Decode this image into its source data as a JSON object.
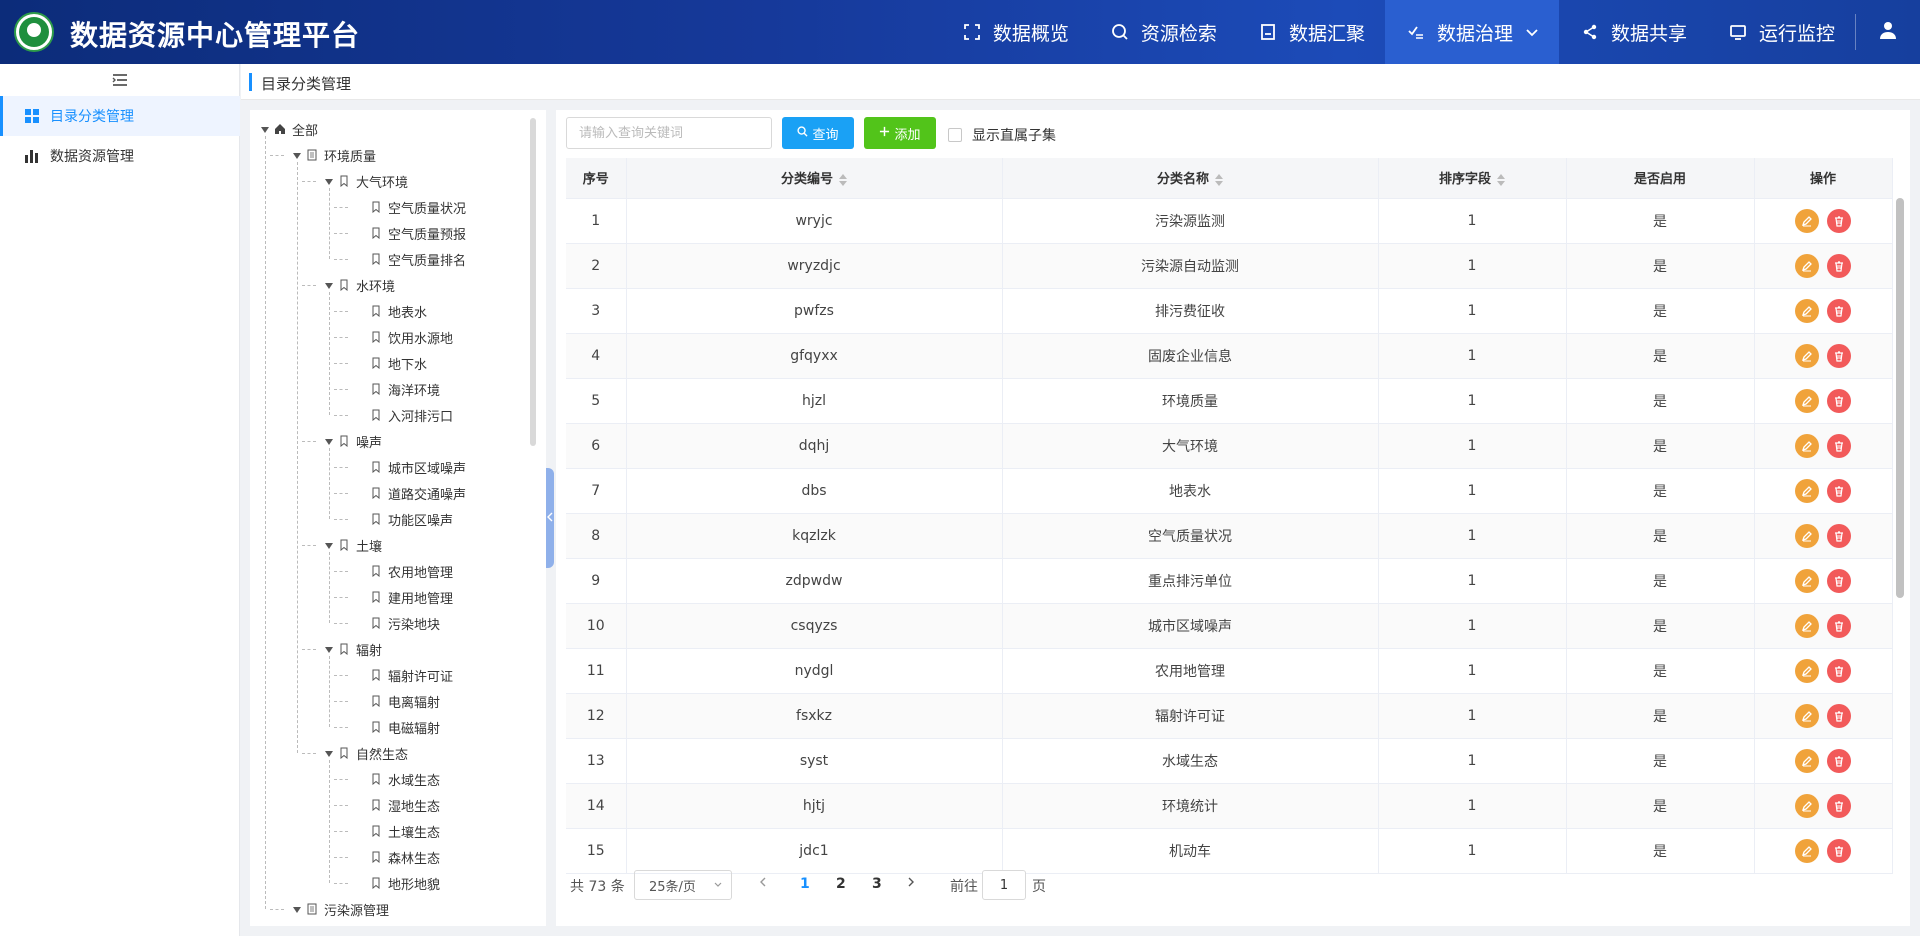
{
  "header": {
    "title": "数据资源中心管理平台",
    "nav": [
      {
        "label": "数据概览",
        "icon": "expand-icon",
        "active": false
      },
      {
        "label": "资源检索",
        "icon": "search-icon",
        "active": false
      },
      {
        "label": "数据汇聚",
        "icon": "document-icon",
        "active": false
      },
      {
        "label": "数据治理",
        "icon": "check-list-icon",
        "active": true
      },
      {
        "label": "数据共享",
        "icon": "share-icon",
        "active": false
      },
      {
        "label": "运行监控",
        "icon": "monitor-icon",
        "active": false
      }
    ],
    "user_icon": "user-icon"
  },
  "sidebar": {
    "items": [
      {
        "label": "目录分类管理",
        "icon": "grid-icon",
        "active": true
      },
      {
        "label": "数据资源管理",
        "icon": "bar-chart-icon",
        "active": false
      }
    ]
  },
  "breadcrumb": "目录分类管理",
  "tree": {
    "root": "全部",
    "l1_env": "环境质量",
    "groups": [
      {
        "label": "大气环境",
        "children": [
          "空气质量状况",
          "空气质量预报",
          "空气质量排名"
        ]
      },
      {
        "label": "水环境",
        "children": [
          "地表水",
          "饮用水源地",
          "地下水",
          "海洋环境",
          "入河排污口"
        ]
      },
      {
        "label": "噪声",
        "children": [
          "城市区域噪声",
          "道路交通噪声",
          "功能区噪声"
        ]
      },
      {
        "label": "土壤",
        "children": [
          "农用地管理",
          "建用地管理",
          "污染地块"
        ]
      },
      {
        "label": "辐射",
        "children": [
          "辐射许可证",
          "电离辐射",
          "电磁辐射"
        ]
      },
      {
        "label": "自然生态",
        "children": [
          "水域生态",
          "湿地生态",
          "土壤生态",
          "森林生态",
          "地形地貌"
        ]
      }
    ],
    "l1_pollution": "污染源管理"
  },
  "toolbar": {
    "search_placeholder": "请输入查询关键词",
    "query_label": "查询",
    "add_label": "添加",
    "checkbox_label": "显示直属子集"
  },
  "table": {
    "headers": [
      "序号",
      "分类编号",
      "分类名称",
      "排序字段",
      "是否启用",
      "操作"
    ],
    "rows": [
      [
        "1",
        "wryjc",
        "污染源监测",
        "1",
        "是"
      ],
      [
        "2",
        "wryzdjc",
        "污染源自动监测",
        "1",
        "是"
      ],
      [
        "3",
        "pwfzs",
        "排污费征收",
        "1",
        "是"
      ],
      [
        "4",
        "gfqyxx",
        "固废企业信息",
        "1",
        "是"
      ],
      [
        "5",
        "hjzl",
        "环境质量",
        "1",
        "是"
      ],
      [
        "6",
        "dqhj",
        "大气环境",
        "1",
        "是"
      ],
      [
        "7",
        "dbs",
        "地表水",
        "1",
        "是"
      ],
      [
        "8",
        "kqzlzk",
        "空气质量状况",
        "1",
        "是"
      ],
      [
        "9",
        "zdpwdw",
        "重点排污单位",
        "1",
        "是"
      ],
      [
        "10",
        "csqyzs",
        "城市区域噪声",
        "1",
        "是"
      ],
      [
        "11",
        "nydgl",
        "农用地管理",
        "1",
        "是"
      ],
      [
        "12",
        "fsxkz",
        "辐射许可证",
        "1",
        "是"
      ],
      [
        "13",
        "syst",
        "水域生态",
        "1",
        "是"
      ],
      [
        "14",
        "hjtj",
        "环境统计",
        "1",
        "是"
      ],
      [
        "15",
        "jdc1",
        "机动车",
        "1",
        "是"
      ]
    ]
  },
  "pagination": {
    "total": "共 73 条",
    "page_size": "25条/页",
    "pages": [
      "1",
      "2",
      "3"
    ],
    "current": "1",
    "goto_label": "前往",
    "goto_value": "1",
    "goto_unit": "页"
  }
}
